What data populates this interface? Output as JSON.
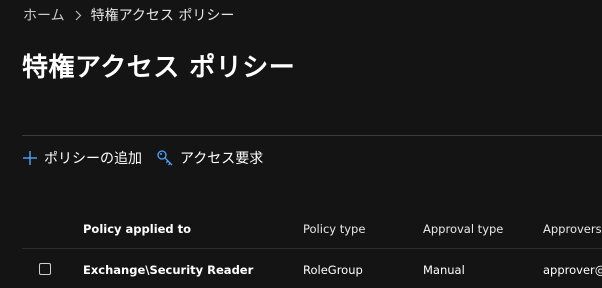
{
  "breadcrumb": {
    "home": "ホーム",
    "current": "特権アクセス ポリシー"
  },
  "page": {
    "title": "特権アクセス ポリシー"
  },
  "toolbar": {
    "add_policy": "ポリシーの追加",
    "access_request": "アクセス要求",
    "add_icon": "plus-icon",
    "request_icon": "key-icon",
    "accent": "#4fa3ff"
  },
  "table": {
    "columns": [
      "Policy applied to",
      "Policy type",
      "Approval type",
      "Approvers"
    ],
    "rows": [
      {
        "policy": "Exchange\\Security Reader",
        "type": "RoleGroup",
        "approval": "Manual",
        "approvers": "approver@"
      }
    ]
  }
}
